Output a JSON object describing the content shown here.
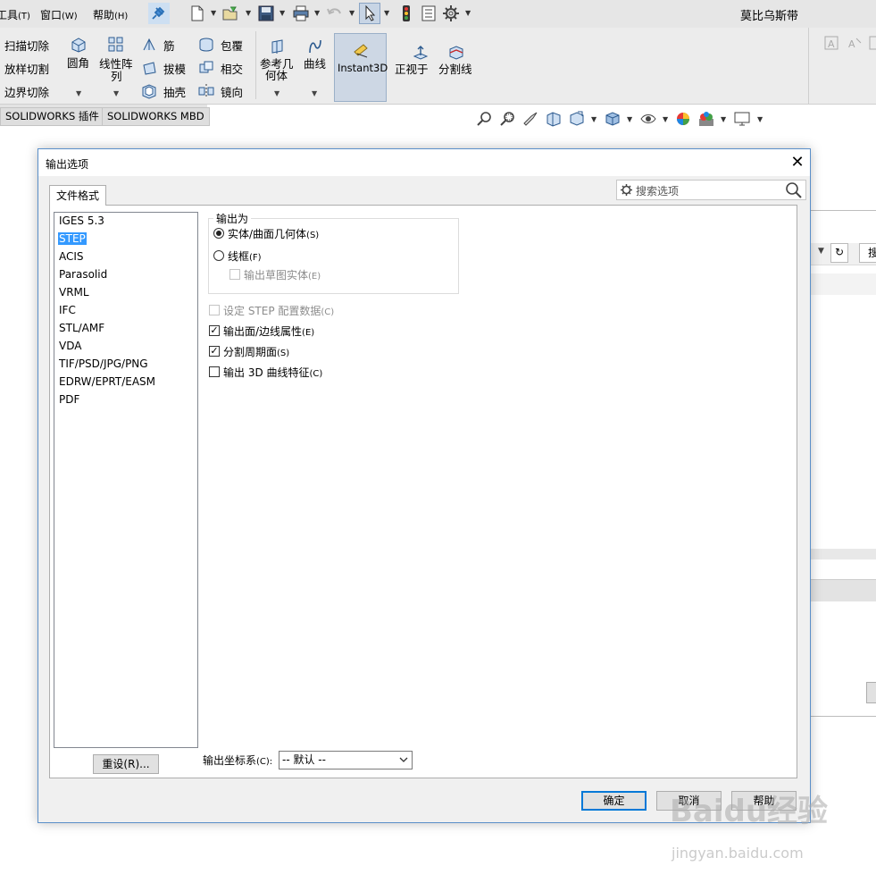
{
  "menubar": {
    "tools_menu": "工具",
    "tools_key": "(T)",
    "window_menu": "窗口",
    "window_key": "(W)",
    "help_menu": "帮助",
    "help_key": "(H)",
    "app_title": "莫比乌斯带"
  },
  "ribbon": {
    "sweep_cut": "扫描切除",
    "loft_cut": "放样切割",
    "boundary_cut": "边界切除",
    "fillet": "圆角",
    "linear_pattern_line1": "线性阵",
    "linear_pattern_line2": "列",
    "rib": "筋",
    "draft": "拔模",
    "shell": "抽壳",
    "wrap": "包覆",
    "intersect": "相交",
    "mirror": "镜向",
    "ref_geometry_line1": "参考几",
    "ref_geometry_line2": "何体",
    "curves": "曲线",
    "instant3d": "Instant3D",
    "normal_to": "正视于",
    "split_line": "分割线"
  },
  "tabs": {
    "addins": "SOLIDWORKS 插件",
    "mbd": "SOLIDWORKS MBD"
  },
  "right_panel": {
    "search_stub": "搜"
  },
  "dialog": {
    "title": "输出选项",
    "tab_label": "文件格式",
    "search_placeholder": "搜索选项",
    "formats": [
      "IGES 5.3",
      "STEP",
      "ACIS",
      "Parasolid",
      "VRML",
      "IFC",
      "STL/AMF",
      "VDA",
      "TIF/PSD/JPG/PNG",
      "EDRW/EPRT/EASM",
      "PDF"
    ],
    "selected_format": "STEP",
    "output_as": "输出为",
    "radio_solid": "实体/曲面几何体",
    "radio_solid_key": "(S)",
    "radio_wireframe": "线框",
    "radio_wireframe_key": "(F)",
    "cb_sketch_entities": "输出草图实体",
    "cb_sketch_entities_key": "(E)",
    "cb_step_config": "设定 STEP 配置数据",
    "cb_step_config_key": "(C)",
    "cb_face_edge_props": "输出面/边线属性",
    "cb_face_edge_props_key": "(E)",
    "cb_split_periodic": "分割周期面",
    "cb_split_periodic_key": "(S)",
    "cb_3d_curves": "输出 3D 曲线特征",
    "cb_3d_curves_key": "(C)",
    "reset_button": "重设(R)...",
    "coord_label": "输出坐标系",
    "coord_label_key": "(C):",
    "coord_value": "-- 默认 --",
    "ok_button": "确定",
    "cancel_button": "取消",
    "help_button": "帮助"
  },
  "watermark": {
    "brand": "Baidu经验",
    "url": "jingyan.baidu.com"
  },
  "colors": {
    "selection": "#3399ff",
    "dialog_border": "#5a8fc9",
    "ok_border": "#0078d7"
  }
}
